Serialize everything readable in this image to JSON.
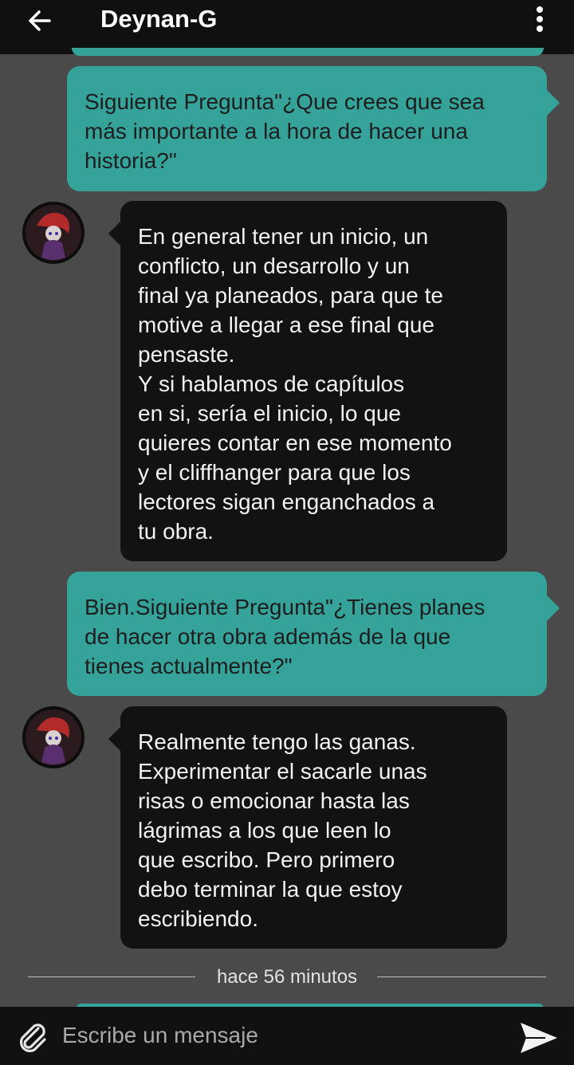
{
  "header": {
    "title": "Deynan-G",
    "back_icon": "arrow-left-icon",
    "menu_icon": "more-vertical-icon"
  },
  "messages": [
    {
      "direction": "outgoing",
      "text": "Siguiente Pregunta\"¿Que crees que sea\nmás importante a la hora de hacer una\nhistoria?\""
    },
    {
      "direction": "incoming",
      "text": "En general tener un inicio, un\nconflicto, un desarrollo y un\nfinal ya planeados, para que te\nmotive a llegar a ese final que\npensaste.\nY si hablamos de capítulos\nen si, sería el inicio, lo que\nquieres contar en ese momento\ny el cliffhanger para que los\nlectores sigan enganchados a\ntu obra."
    },
    {
      "direction": "outgoing",
      "text": "Bien.Siguiente Pregunta\"¿Tienes planes\nde hacer otra obra además de la que\ntienes actualmente?\""
    },
    {
      "direction": "incoming",
      "text": "Realmente tengo las ganas.\nExperimentar el sacarle unas\nrisas o emocionar hasta las\nlágrimas a los que leen lo\nque escribo. Pero primero\ndebo terminar la que estoy\nescribiendo."
    }
  ],
  "timestamp": "hace 56 minutos",
  "composer": {
    "placeholder": "Escribe un mensaje",
    "attach_icon": "paperclip-icon",
    "send_icon": "send-icon"
  },
  "colors": {
    "outgoing_bubble": "#35a39a",
    "incoming_bubble": "#121212",
    "background": "#4a4a4a",
    "bars": "#101010"
  }
}
